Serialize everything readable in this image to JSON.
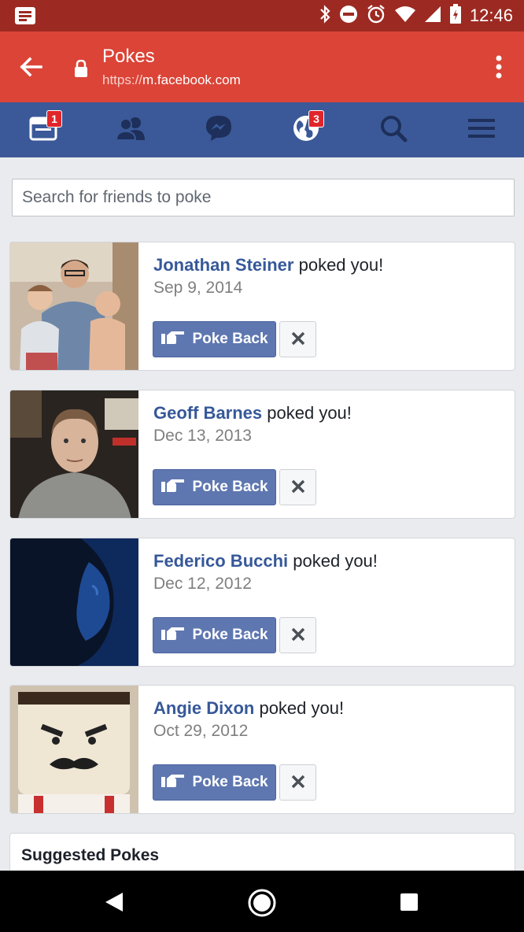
{
  "status_bar": {
    "time": "12:46",
    "colors": {
      "bg": "#9c2a22"
    }
  },
  "browser": {
    "title": "Pokes",
    "url_protocol": "https://",
    "url_host": "m.facebook.com",
    "colors": {
      "bg": "#db4437"
    }
  },
  "fb_nav": {
    "colors": {
      "bg": "#3b5998"
    },
    "items": [
      {
        "icon": "news-feed-icon",
        "badge": "1"
      },
      {
        "icon": "friends-icon",
        "badge": ""
      },
      {
        "icon": "messenger-icon",
        "badge": ""
      },
      {
        "icon": "notifications-globe-icon",
        "badge": "3"
      },
      {
        "icon": "search-icon",
        "badge": ""
      },
      {
        "icon": "menu-icon",
        "badge": ""
      }
    ]
  },
  "search": {
    "placeholder": "Search for friends to poke"
  },
  "pokes": [
    {
      "name": "Jonathan Steiner",
      "action": " poked you!",
      "date": "Sep 9, 2014"
    },
    {
      "name": "Geoff Barnes",
      "action": " poked you!",
      "date": "Dec 13, 2013"
    },
    {
      "name": "Federico Bucchi",
      "action": " poked you!",
      "date": "Dec 12, 2012"
    },
    {
      "name": "Angie Dixon",
      "action": " poked you!",
      "date": "Oct 29, 2012"
    }
  ],
  "poke_back_label": "Poke Back",
  "suggested_title": "Suggested Pokes"
}
